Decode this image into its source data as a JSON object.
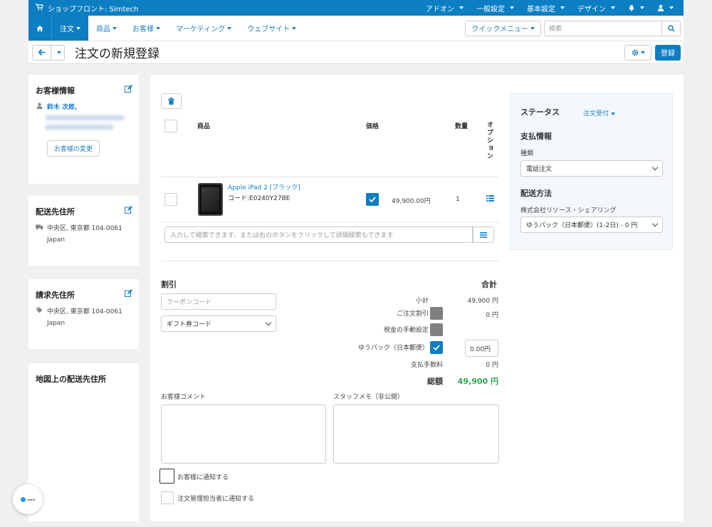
{
  "topbar": {
    "store": "ショップフロント: Simtech",
    "menus": [
      "アドオン",
      "一般設定",
      "基本設定",
      "デザイン"
    ]
  },
  "nav": {
    "items": [
      "注文",
      "商品",
      "お客様",
      "マーケティング",
      "ウェブサイト"
    ],
    "quick_menu": "クイックメニュー",
    "search_placeholder": "検索"
  },
  "page": {
    "title": "注文の新規登録",
    "create_button": "登録"
  },
  "customer": {
    "title": "お客様情報",
    "name": "鈴木 次郎,",
    "change_button": "お客様の変更"
  },
  "shipping_address": {
    "title": "配送先住所",
    "line1": "中央区, 東京都 104-0061",
    "line2": "Japan"
  },
  "billing_address": {
    "title": "請求先住所",
    "line1": "中央区, 東京都 104-0061",
    "line2": "Japan"
  },
  "map": {
    "title": "地図上の配送先住所"
  },
  "products": {
    "headers": {
      "product": "商品",
      "price": "価格",
      "qty": "数量",
      "options": "オプション"
    },
    "items": [
      {
        "name": "Apple iPad 2 [ブラック]",
        "code": "コード:E0240Y27BE",
        "price": "49,900.00円",
        "qty": "1"
      }
    ],
    "search_placeholder": "入力して検索できます、または右のボタンをクリックして詳細検索もできます"
  },
  "discount": {
    "title": "割引",
    "coupon_placeholder": "クーポンコード",
    "gift_select": "ギフト券コード"
  },
  "totals": {
    "title": "合計",
    "subtotal_label": "小計",
    "subtotal": "49,900 円",
    "order_discount_label": "ご注文割引",
    "order_discount": "0 円",
    "tax_label": "税金の手動設定",
    "shipping_label": "ゆうパック（日本郵便）",
    "shipping_value": "0.00円",
    "payment_fee_label": "支払手数料",
    "payment_fee": "0 円",
    "total_label": "総額",
    "total": "49,900 円"
  },
  "comments": {
    "customer_label": "お客様コメント",
    "staff_label": "スタッフメモ（非公開）"
  },
  "notify": {
    "customer": "お客様に通知する",
    "admin": "注文管理担当者に通知する"
  },
  "status": {
    "title": "ステータス",
    "value": "注文受付",
    "payment_title": "支払情報",
    "payment_type_label": "種類",
    "payment_type": "電話注文",
    "shipping_title": "配送方法",
    "shipping_company": "株式会社リソース・シェアリング",
    "shipping_method": "ゆうパック（日本郵便）(1-2日) - 0 円"
  },
  "colors": {
    "accent": "#0c7ec2",
    "total_green": "#2fa84f"
  }
}
